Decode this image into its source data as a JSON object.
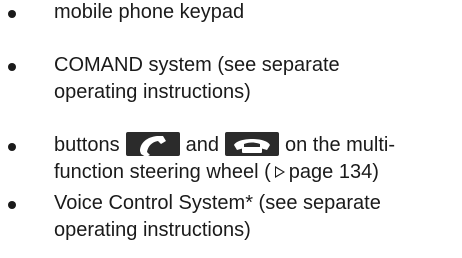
{
  "bullets": [
    {
      "lines": [
        "mobile phone keypad"
      ]
    },
    {
      "lines": [
        "COMAND system (see separate",
        "operating instructions)"
      ]
    },
    {
      "line1_prefix": "buttons",
      "line1_between": "and",
      "line1_suffix": "on the multi-",
      "line2_prefix": "function steering wheel (",
      "page_ref": "page 134",
      "line2_suffix": ")",
      "icons": [
        "phone-pickup-icon",
        "phone-hangup-icon"
      ]
    },
    {
      "lines": [
        "Voice Control System* (see separate",
        "operating instructions)"
      ]
    }
  ],
  "colors": {
    "text": "#1a1a1a",
    "button_bg": "#2b2b2b",
    "button_fg": "#ffffff"
  }
}
